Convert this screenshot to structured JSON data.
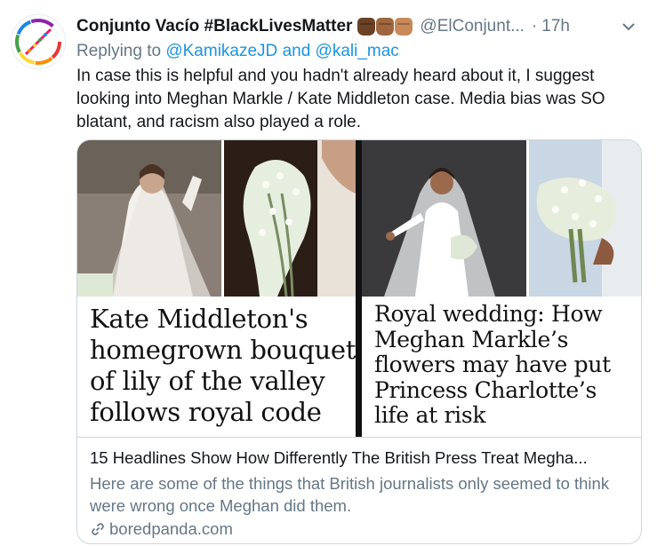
{
  "tweet": {
    "display_name": "Conjunto Vacío #BlackLivesMatter",
    "handle": "@ElConjunt...",
    "separator": "·",
    "timestamp": "17h",
    "reply_prefix": "Replying to",
    "reply_user1": "@KamikazeJD",
    "reply_and": "and",
    "reply_user2": "@kali_mac",
    "text": "In case this is helpful and you hadn't already heard about it, I suggest looking into Meghan Markle / Kate Middleton case. Media bias was SO blatant, and racism also played a role.",
    "emoji_fist_colors": [
      "#6b4226",
      "#a0673f",
      "#c98a5b"
    ]
  },
  "card": {
    "image": {
      "headline_left": "Kate Middleton's homegrown bouquet of lily of the valley follows royal code",
      "headline_right": "Royal wedding: How Meghan Markle’s flowers may have put Princess Charlotte’s life at risk"
    },
    "title": "15 Headlines Show How Differently The British Press Treat Megha...",
    "description": "Here are some of the things that British journalists only seemed to think were wrong once Meghan did them.",
    "domain": "boredpanda.com"
  },
  "icons": {
    "caret": "chevron-down-icon",
    "link": "link-icon"
  },
  "colors": {
    "link": "#1b95e0",
    "secondary_text": "#657786",
    "primary_text": "#14171a",
    "border": "#ccd6dd"
  }
}
